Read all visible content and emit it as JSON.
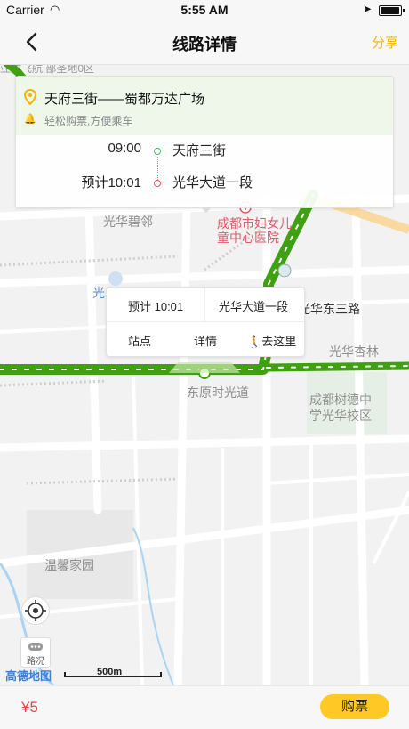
{
  "status_bar": {
    "carrier": "Carrier",
    "time": "5:55 AM"
  },
  "nav": {
    "title": "线路详情",
    "share": "分享"
  },
  "route_card": {
    "route_name": "天府三街——蜀都万达广场",
    "tip": "轻松购票,方便乘车",
    "stops": [
      {
        "time": "09:00",
        "name": "天府三街"
      },
      {
        "time": "预计10:01",
        "name": "光华大道一段"
      }
    ]
  },
  "map": {
    "pois": [
      {
        "label": "光华碧邻"
      },
      {
        "label": "成都市妇女儿"
      },
      {
        "label": "童中心医院"
      },
      {
        "label": "光华东三路"
      },
      {
        "label": "光华杏林"
      },
      {
        "label": "东原时光道"
      },
      {
        "label": "成都树德中"
      },
      {
        "label": "学光华校区"
      },
      {
        "label": "温馨家园"
      },
      {
        "label": "光"
      }
    ],
    "traffic_label": "路况",
    "logo": "高德地图",
    "scale": "500m",
    "route_color": "#3fa012"
  },
  "popup": {
    "eta": "预计 10:01",
    "stop_name": "光华大道一段",
    "btn_station": "站点",
    "btn_detail": "详情",
    "btn_go": "去这里"
  },
  "bottom": {
    "price": "¥5",
    "buy": "购票"
  }
}
